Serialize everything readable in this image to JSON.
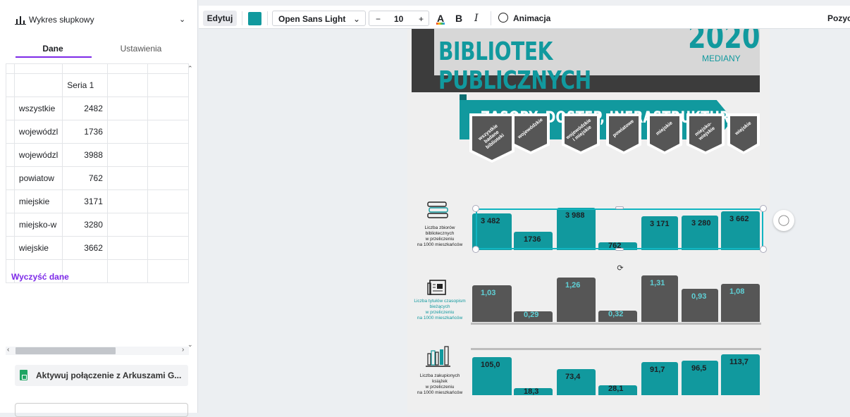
{
  "panel": {
    "chart_type": "Wykres słupkowy",
    "tabs": [
      {
        "label": "Dane"
      },
      {
        "label": "Ustawienia"
      }
    ],
    "series_header": "Seria 1",
    "rows": [
      {
        "label": "wszystkie",
        "value": "2482"
      },
      {
        "label": "wojewódzl",
        "value": "1736"
      },
      {
        "label": "wojewódzl",
        "value": "3988"
      },
      {
        "label": "powiatow",
        "value": "762"
      },
      {
        "label": "miejskie",
        "value": "3171"
      },
      {
        "label": "miejsko-w",
        "value": "3280"
      },
      {
        "label": "wiejskie",
        "value": "3662"
      }
    ],
    "clear_label": "Wyczyść dane",
    "sheets_label": "Aktywuj połączenie z Arkuszami G..."
  },
  "toolbar": {
    "edit": "Edytuj",
    "color": "#11999e",
    "font": "Open Sans Light",
    "size_minus": "−",
    "size": "10",
    "size_plus": "+",
    "text_color": "A",
    "bold": "B",
    "italic": "I",
    "animation": "Animacja",
    "position": "Pozycja"
  },
  "infographic": {
    "title": "BIBLIOTEK PUBLICZNYCH",
    "year": "2020",
    "medians": "MEDIANY",
    "section": "ZASOBY, DOSTĘP, INFRASTRUKTURA",
    "badges": [
      "wszystkie\nbadane\nbiblioteki",
      "wojewódzkie",
      "wojewódzkie\ni miejskie",
      "powiatowe",
      "miejskie",
      "miejsko-\nwiejskie",
      "wiejskie"
    ],
    "row_labels": [
      "Liczba zbiorów\nbibliotecznych\nw przeliczeniu\nna 1000 mieszkańców",
      "Liczba tytułów czasopism\nbieżących\nw przeliczeniu\nna 1000 mieszkańców",
      "Liczba zakupionych\nksiążek\nw przeliczeniu\nna 1000 mieszkańców"
    ],
    "accent": "#11999e",
    "dark": "#565656"
  },
  "chart_data": [
    {
      "type": "bar",
      "categories": [
        "wszystkie",
        "wojewódzkie",
        "wojewódzkie i miejskie",
        "powiatowe",
        "miejskie",
        "miejsko-wiejskie",
        "wiejskie"
      ],
      "values": [
        3482,
        1736,
        3988,
        762,
        3171,
        3280,
        3662
      ],
      "labels": [
        "3 482",
        "1736",
        "3 988",
        "762",
        "3 171",
        "3 280",
        "3 662"
      ],
      "color": "#11999e"
    },
    {
      "type": "bar",
      "categories": [
        "wszystkie",
        "wojewódzkie",
        "wojewódzkie i miejskie",
        "powiatowe",
        "miejskie",
        "miejsko-wiejskie",
        "wiejskie"
      ],
      "values": [
        1.03,
        0.29,
        1.26,
        0.32,
        1.31,
        0.93,
        1.08
      ],
      "labels": [
        "1,03",
        "0,29",
        "1,26",
        "0,32",
        "1,31",
        "0,93",
        "1,08"
      ],
      "color": "#565656"
    },
    {
      "type": "bar",
      "categories": [
        "wszystkie",
        "wojewódzkie",
        "wojewódzkie i miejskie",
        "powiatowe",
        "miejskie",
        "miejsko-wiejskie",
        "wiejskie"
      ],
      "values": [
        105.0,
        18.3,
        73.4,
        28.1,
        91.7,
        96.5,
        113.7
      ],
      "labels": [
        "105,0",
        "18,3",
        "73,4",
        "28,1",
        "91,7",
        "96,5",
        "113,7"
      ],
      "color": "#11999e"
    }
  ]
}
